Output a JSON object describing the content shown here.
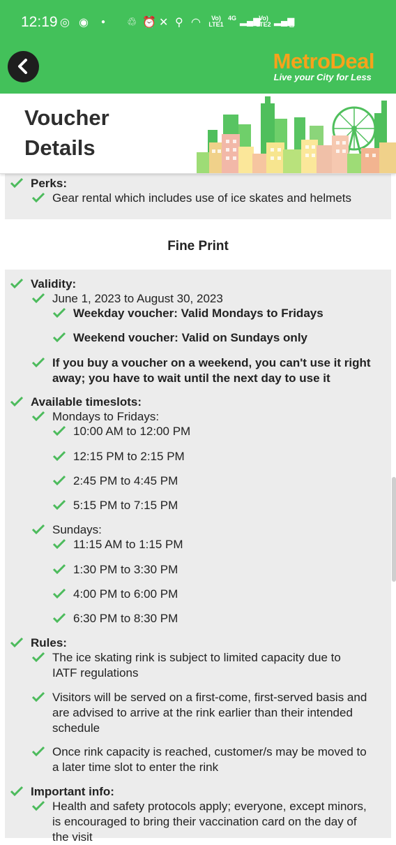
{
  "status_bar": {
    "time": "12:19",
    "net1": "Vo) LTE1",
    "net2": "4G",
    "net3": "Vo) LTE2"
  },
  "header": {
    "brand_metro": "Metro",
    "brand_deal": "Deal",
    "tagline": "Live your City for Less"
  },
  "page": {
    "title": "Voucher Details"
  },
  "perks": {
    "heading": "Perks:",
    "items": [
      "Gear rental which includes use of ice skates and helmets"
    ]
  },
  "fine_print": {
    "heading": "Fine Print",
    "validity_heading": "Validity:",
    "validity_dates": "June 1, 2023 to August 30, 2023",
    "weekday": "Weekday voucher: Valid Mondays to Fridays",
    "weekend": "Weekend voucher: Valid on Sundays only",
    "weekend_note_1": "If you buy a voucher on a weekend, you can't use it right",
    "weekend_note_2": "away; you have to wait until the next day to use it",
    "timeslots_heading": "Available timeslots:",
    "weekdays_label": "Mondays to Fridays:",
    "weekday_slots": [
      "10:00 AM to 12:00 PM",
      "12:15 PM to 2:15 PM",
      "2:45 PM to 4:45 PM",
      "5:15 PM to 7:15 PM"
    ],
    "sundays_label": "Sundays:",
    "sunday_slots": [
      "11:15 AM to 1:15 PM",
      "1:30 PM to 3:30 PM",
      "4:00 PM to 6:00 PM",
      "6:30 PM to 8:30 PM"
    ],
    "rules_heading": "Rules:",
    "rule1_l1": "The ice skating rink is subject to limited capacity due to",
    "rule1_l2": "IATF regulations",
    "rule2_l1": "Visitors will be served on a first-come, first-served basis and",
    "rule2_l2": "are advised to arrive at the rink earlier than their intended",
    "rule2_l3": "schedule",
    "rule3_l1": "Once rink capacity is reached, customer/s may be moved to",
    "rule3_l2": "a later time slot to enter the rink",
    "info_heading": "Important info:",
    "info1_l1": "Health and safety protocols apply; everyone, except minors,",
    "info1_l2": "is encouraged to bring their vaccination card on the day of",
    "info1_l3": "the visit"
  },
  "colors": {
    "brand_green": "#43c15a",
    "brand_orange": "#f7a21b",
    "check_green": "#4cbb5c",
    "card_bg": "#ececec"
  }
}
